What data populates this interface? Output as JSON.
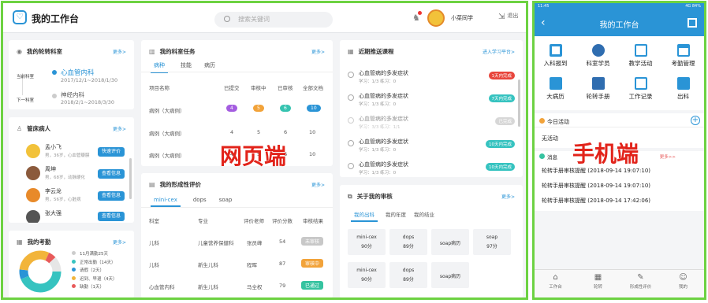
{
  "web": {
    "app_title": "我的工作台",
    "search_placeholder": "搜索关键词",
    "user_name": "小菜同学",
    "logout": "退出",
    "label": "网页端",
    "rotation": {
      "title": "我的轮转科室",
      "more": "更多>",
      "current_label": "当前科室",
      "current_dept": "心血管内科",
      "current_dates": "2017/12/1~2018/1/30",
      "next_label": "下一科室",
      "next_dept": "神经内科",
      "next_dates": "2018/2/1~2018/3/30"
    },
    "patients": {
      "title": "管床病人",
      "more": "更多>",
      "items": [
        {
          "name": "孟小飞",
          "detail": "男，36岁，心血管瓣膜",
          "action": "快速评价"
        },
        {
          "name": "周坤",
          "detail": "男，68岁，动脉硬化",
          "action": "查看信息"
        },
        {
          "name": "李云龙",
          "detail": "男，56岁，心脏病",
          "action": "查看信息"
        },
        {
          "name": "张大强",
          "detail": "",
          "action": "查看信息"
        }
      ]
    },
    "attendance": {
      "title": "我的考勤",
      "more": "更多>",
      "items": [
        {
          "label": "11月满勤25天",
          "color": "#cccccc"
        },
        {
          "label": "正常出勤（14天）",
          "color": "#36c3c0"
        },
        {
          "label": "请假（2天）",
          "color": "#2a94d6"
        },
        {
          "label": "迟到、早退（4天）",
          "color": "#f2b43a"
        },
        {
          "label": "缺勤（1天）",
          "color": "#e85a5a"
        }
      ]
    },
    "tasks": {
      "title": "我的科室任务",
      "more": "更多>",
      "tabs": [
        "病种",
        "技能",
        "病历"
      ],
      "headers": [
        "项目名称",
        "已提交",
        "审核中",
        "已审核",
        "全部文档"
      ],
      "rows": [
        {
          "name": "病例（大病例）",
          "v": [
            "4",
            "5",
            "6",
            "10"
          ]
        },
        {
          "name": "病例（大病例）",
          "v": [
            "4",
            "5",
            "6",
            "10"
          ]
        },
        {
          "name": "病例（大病例）",
          "v": [
            "4",
            "5",
            "6",
            "10"
          ]
        }
      ]
    },
    "formative": {
      "title": "我的形成性评价",
      "more": "更多>",
      "tabs": [
        "mini-cex",
        "dops",
        "soap"
      ],
      "headers": [
        "科室",
        "专业",
        "评价老师",
        "评价分数",
        "审核结果"
      ],
      "rows": [
        {
          "dept": "儿科",
          "major": "儿童营养保健科",
          "teacher": "张员峰",
          "score": "54",
          "status": "未审核",
          "color": "#c8c8c8"
        },
        {
          "dept": "儿科",
          "major": "新生儿科",
          "teacher": "程晖",
          "score": "87",
          "status": "审核中",
          "color": "#f2a33a"
        },
        {
          "dept": "心血管内科",
          "major": "新生儿科",
          "teacher": "马全权",
          "score": "79",
          "status": "已通过",
          "color": "#36c3a0"
        }
      ]
    },
    "courses": {
      "title": "近期推送课程",
      "more": "进入学习平台>",
      "items": [
        {
          "name": "心血管病的多发症状",
          "stats": "学习：1/3    练习：0",
          "badge": "1天内完成",
          "color": "#e8453c"
        },
        {
          "name": "心血管病的多发症状",
          "stats": "学习：1/3    练习：0",
          "badge": "7天内完成",
          "color": "#36c3c0"
        },
        {
          "name": "心血管病的多发症状",
          "stats": "学习：3/3    练习：1/1",
          "badge": "已完成",
          "color": "#c8c8c8"
        },
        {
          "name": "心血管病的多发症状",
          "stats": "学习：1/3    练习：0",
          "badge": "10天内完成",
          "color": "#36c3c0"
        },
        {
          "name": "心血管病的多发症状",
          "stats": "学习：1/3    练习：0",
          "badge": "10天内完成",
          "color": "#36c3c0"
        }
      ]
    },
    "reviews": {
      "title": "关于我的审核",
      "more": "更多>",
      "tabs": [
        "我的出科",
        "我的年度",
        "我的结业"
      ],
      "cards": [
        {
          "a": "mini-cex",
          "b": "90分"
        },
        {
          "a": "dops",
          "b": "89分"
        },
        {
          "a": "soap病历",
          "b": ""
        },
        {
          "a": "soap",
          "b": "97分"
        },
        {
          "a": "mini-cex",
          "b": "90分"
        },
        {
          "a": "dops",
          "b": "89分"
        },
        {
          "a": "soap病历",
          "b": ""
        }
      ]
    }
  },
  "mobile": {
    "label": "手机端",
    "status_time": "11:45",
    "status_right": "4G 84%",
    "title": "我的工作台",
    "icons": [
      {
        "label": "入科报到",
        "color": "#2a94d6"
      },
      {
        "label": "科室学员",
        "color": "#2a94d6"
      },
      {
        "label": "教学活动",
        "color": "#2a94d6"
      },
      {
        "label": "考勤管理",
        "color": "#2a94d6"
      },
      {
        "label": "大病历",
        "color": "#2a94d6"
      },
      {
        "label": "轮转手册",
        "color": "#2a94d6"
      },
      {
        "label": "工作记录",
        "color": "#2a94d6"
      },
      {
        "label": "出科",
        "color": "#2a94d6"
      }
    ],
    "today_title": "今日活动",
    "today_empty": "无活动",
    "msg_title": "消息",
    "msg_more": "更多>>",
    "messages": [
      "轮转手册审核提醒  (2018-09-14 19:07:10)",
      "轮转手册审核提醒  (2018-09-14 19:07:10)",
      "轮转手册审核提醒  (2018-09-14 17:42:06)"
    ],
    "tabs": [
      "工作台",
      "轮转",
      "形成性评价",
      "我的"
    ]
  }
}
